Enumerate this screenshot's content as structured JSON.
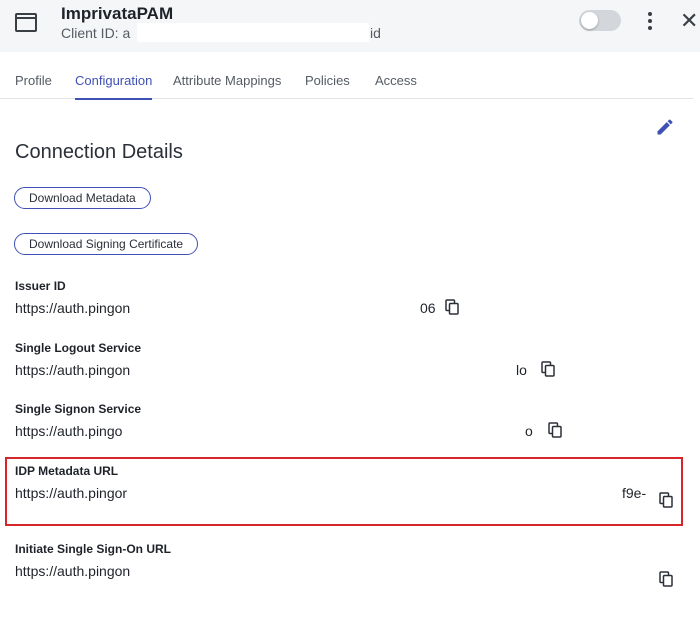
{
  "header": {
    "app_title": "ImprivataPAM",
    "client_id_prefix": "Client ID: a",
    "client_id_suffix": "id",
    "toggle_on": false,
    "icons": {
      "app": "window-icon",
      "more": "kebab-menu-icon",
      "close": "close-icon"
    }
  },
  "tabs": [
    {
      "label": "Profile",
      "active": false
    },
    {
      "label": "Configuration",
      "active": true
    },
    {
      "label": "Attribute Mappings",
      "active": false
    },
    {
      "label": "Policies",
      "active": false
    },
    {
      "label": "Access",
      "active": false
    }
  ],
  "section": {
    "title": "Connection Details",
    "edit_icon": "pencil-icon"
  },
  "buttons": {
    "download_metadata": "Download Metadata",
    "download_certificate": "Download Signing Certificate"
  },
  "fields": [
    {
      "label": "Issuer ID",
      "value_start": "https://auth.pingon",
      "value_end": "06"
    },
    {
      "label": "Single Logout Service",
      "value_start": "https://auth.pingon",
      "value_end": "lo"
    },
    {
      "label": "Single Signon Service",
      "value_start": "https://auth.pingo",
      "value_end": "o"
    },
    {
      "label": "IDP Metadata URL",
      "value_start": "https://auth.pingor",
      "value_end": "f9e-"
    },
    {
      "label": "Initiate Single Sign-On URL",
      "value_start": "https://auth.pingon",
      "value_end": ""
    }
  ],
  "colors": {
    "accent": "#3f51b5",
    "highlight": "#d6262b",
    "header_bg": "#f5f6f8"
  }
}
